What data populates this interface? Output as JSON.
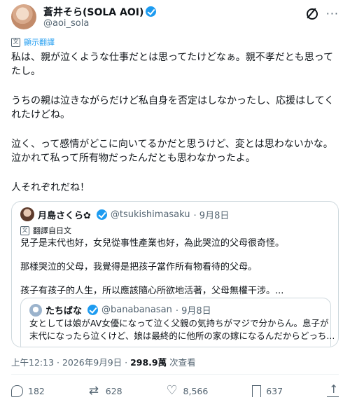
{
  "author": {
    "name": "蒼井そら(SOLA AOI)",
    "handle": "@aoi_sola"
  },
  "translate_label": "顯示翻譯",
  "tweet": {
    "paragraphs": [
      "私は、親が泣くような仕事だとは思ってたけどなぁ。親不孝だとも思ってたし。",
      "うちの親は泣きながらだけど私自身を否定はしなかったし、応援はしてくれたけどね。",
      "泣く、って感情がどこに向いてるかだと思うけど、変とは思わないかな。泣かれて私って所有物だったんだとも思わなかったよ。",
      "人それぞれだね！"
    ]
  },
  "quote": {
    "name": "月島さくら✿",
    "handle": "@tsukishimasaku",
    "date": "· 9月8日",
    "translated_label": "翻譯自日文",
    "lines": [
      "兒子是末代也好，女兒從事性產業也好，為此哭泣的父母很奇怪。",
      "那樣哭泣的父母，我覺得是把孩子當作所有物看待的父母。",
      "孩子有孩子的人生，所以應該隨心所欲地活著，父母無權干涉。..."
    ],
    "nested": {
      "name": "たちばな",
      "handle": "@banabanasan",
      "date": "· 9月8日",
      "line1": "女としては娘がAV女優になって泣く父親の気持ちがマジで分からん。息子が",
      "line2": "末代になったら泣くけど、娘は最終的に他所の家の嫁になるんだからどっち..."
    }
  },
  "timestamp": "上午12:13 · 2026年9月9日 · ",
  "views_count": "298.9萬",
  "views_label": " 次查看",
  "stats": {
    "replies": "182",
    "retweets": "628",
    "likes": "8,566",
    "bookmarks": "637"
  },
  "icons": [
    "verified-badge-icon",
    "grok-icon",
    "more-icon",
    "translate-icon",
    "reply-icon",
    "retweet-icon",
    "like-icon",
    "bookmark-icon",
    "share-icon"
  ],
  "colors": {
    "accent": "#1d9bf0",
    "secondary_text": "#536471",
    "border": "#cfd9de"
  }
}
